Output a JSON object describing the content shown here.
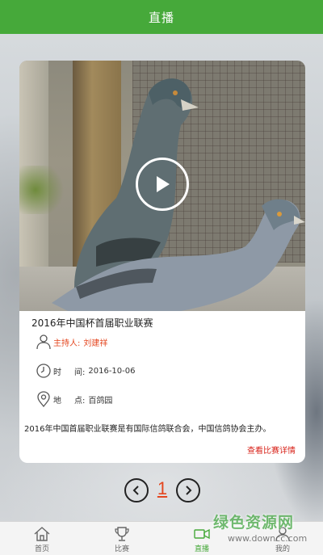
{
  "header": {
    "title": "直播"
  },
  "live_card": {
    "title": "2016年中国杯首届职业联赛",
    "host_label": "主持人:",
    "host_name": "刘建祥",
    "time_label": "时",
    "time_label2": "间:",
    "time_value": "2016-10-06",
    "place_label": "地",
    "place_label2": "点:",
    "place_value": "百鸽园",
    "description": "2016年中国首届职业联赛是有国际信鸽联合会，中国信鸽协会主办。",
    "detail_link": "查看比赛详情",
    "play_icon": "play-icon"
  },
  "pager": {
    "current_page": "1"
  },
  "tabs": [
    {
      "label": "首页",
      "icon": "home-icon"
    },
    {
      "label": "比赛",
      "icon": "trophy-icon"
    },
    {
      "label": "直播",
      "icon": "video-camera-icon",
      "active": true
    },
    {
      "label": "我的",
      "icon": "user-icon"
    }
  ],
  "watermark": {
    "main": "绿色资源网",
    "sub": "www.downcc.com"
  },
  "colors": {
    "brand_green": "#46a93a",
    "accent_red": "#e4461f",
    "link_red": "#d8241b"
  }
}
